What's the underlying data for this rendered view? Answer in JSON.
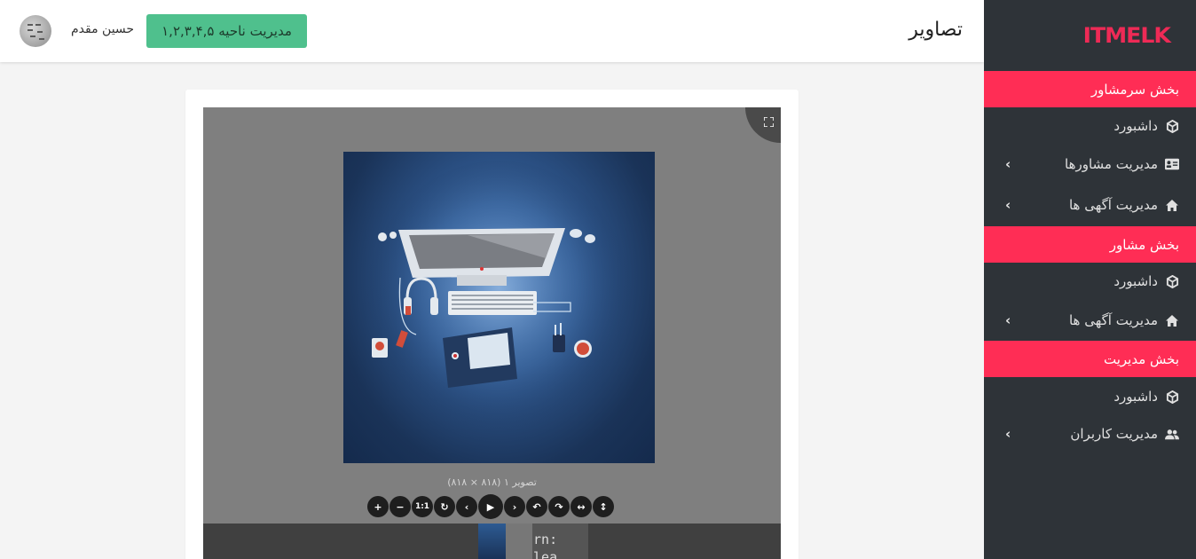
{
  "sidebar": {
    "logo": "itmelk",
    "sections": [
      {
        "title": "بخش سرمشاور",
        "items": [
          {
            "label": "داشبورد",
            "icon": "cube-icon",
            "has_submenu": false
          },
          {
            "label": "مدیریت مشاورها",
            "icon": "id-card-icon",
            "has_submenu": true
          },
          {
            "label": "مدیریت آگهی ها",
            "icon": "home-icon",
            "has_submenu": true
          }
        ]
      },
      {
        "title": "بخش مشاور",
        "items": [
          {
            "label": "داشبورد",
            "icon": "cube-icon",
            "has_submenu": false
          },
          {
            "label": "مدیریت آگهی ها",
            "icon": "home-icon",
            "has_submenu": true
          }
        ]
      },
      {
        "title": "بخش مدیریت",
        "items": [
          {
            "label": "داشبورد",
            "icon": "cube-icon",
            "has_submenu": false
          },
          {
            "label": "مدیریت کاربران",
            "icon": "users-icon",
            "has_submenu": true
          }
        ]
      }
    ]
  },
  "header": {
    "title": "تصاویر",
    "region_button": "مدیریت ناحیه ۱,۲,۳,۴,۵",
    "user_name": "حسین مقدم"
  },
  "viewer": {
    "caption": "(تصویر ۱ (۸۱۸ × ۸۱۸",
    "thumb_text": "arn:\n:lea",
    "toolbar": [
      "zoom-in",
      "zoom-out",
      "one-to-one",
      "reset",
      "prev",
      "play",
      "next",
      "rotate-left",
      "rotate-right",
      "flip-horizontal",
      "flip-vertical"
    ],
    "one_to_one_label": "1:1"
  },
  "colors": {
    "sidebar_bg": "#2e3338",
    "section_accent": "#ff2d55",
    "button_green": "#4fc08d",
    "logo": "#ee2a56"
  }
}
